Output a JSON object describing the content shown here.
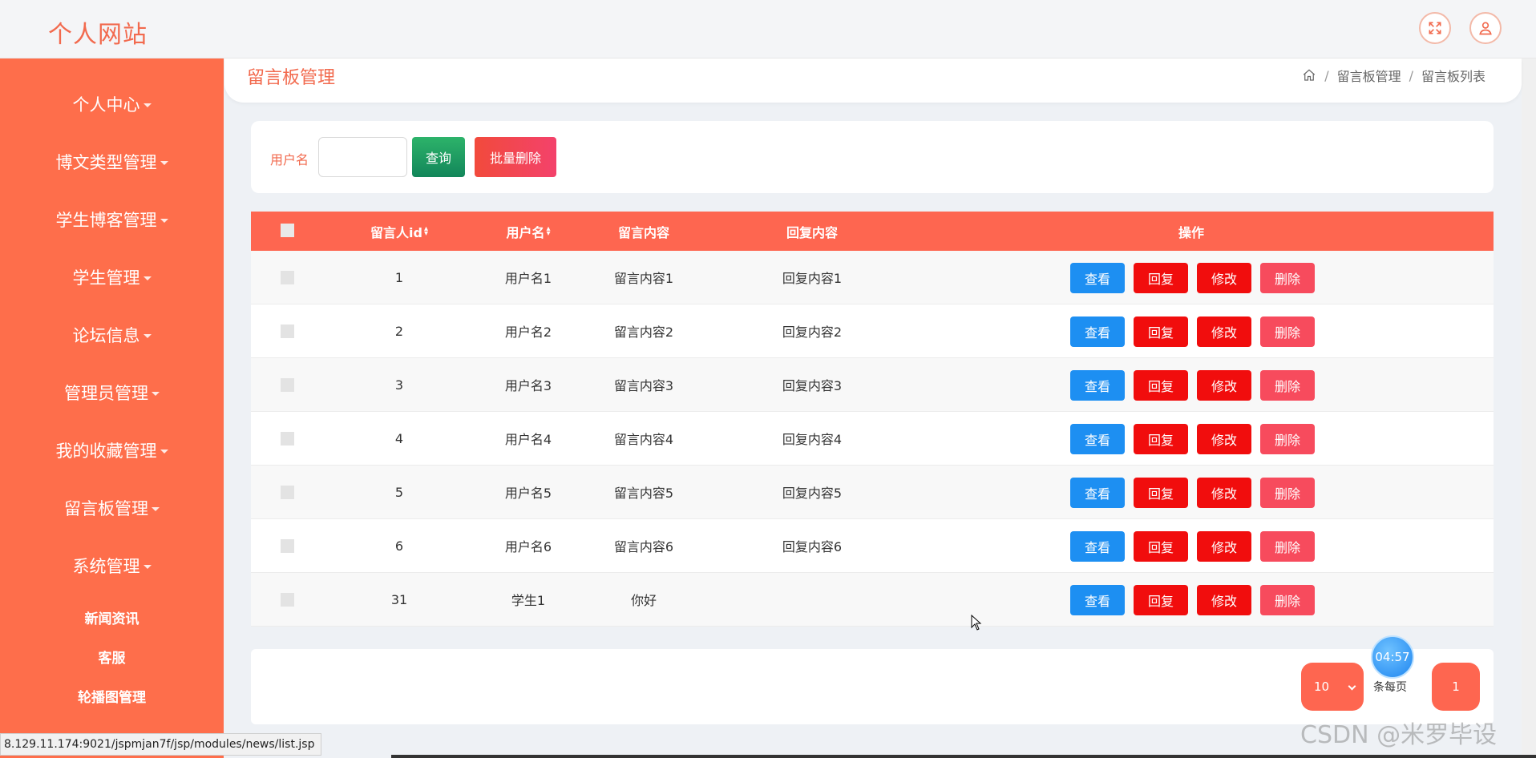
{
  "header": {
    "site_title": "个人网站",
    "fullscreen_icon": "expand-icon",
    "user_icon": "user-icon"
  },
  "sidebar": {
    "items": [
      {
        "label": "个人中心"
      },
      {
        "label": "博文类型管理"
      },
      {
        "label": "学生博客管理"
      },
      {
        "label": "学生管理"
      },
      {
        "label": "论坛信息"
      },
      {
        "label": "管理员管理"
      },
      {
        "label": "我的收藏管理"
      },
      {
        "label": "留言板管理"
      },
      {
        "label": "系统管理"
      }
    ],
    "sub_items": [
      {
        "label": "新闻资讯"
      },
      {
        "label": "客服"
      },
      {
        "label": "轮播图管理"
      }
    ]
  },
  "page": {
    "title": "留言板管理",
    "breadcrumb": [
      "留言板管理",
      "留言板列表"
    ],
    "breadcrumb_separator": "/"
  },
  "search": {
    "label": "用户名",
    "input_value": "",
    "query_label": "查询",
    "batch_delete_label": "批量删除"
  },
  "table": {
    "columns": [
      "留言人id",
      "用户名",
      "留言内容",
      "回复内容",
      "操作"
    ],
    "actions": {
      "view": "查看",
      "reply": "回复",
      "edit": "修改",
      "delete": "删除"
    },
    "rows": [
      {
        "id": "1",
        "username": "用户名1",
        "content": "留言内容1",
        "reply": "回复内容1"
      },
      {
        "id": "2",
        "username": "用户名2",
        "content": "留言内容2",
        "reply": "回复内容2"
      },
      {
        "id": "3",
        "username": "用户名3",
        "content": "留言内容3",
        "reply": "回复内容3"
      },
      {
        "id": "4",
        "username": "用户名4",
        "content": "留言内容4",
        "reply": "回复内容4"
      },
      {
        "id": "5",
        "username": "用户名5",
        "content": "留言内容5",
        "reply": "回复内容5"
      },
      {
        "id": "6",
        "username": "用户名6",
        "content": "留言内容6",
        "reply": "回复内容6"
      },
      {
        "id": "31",
        "username": "学生1",
        "content": "你好",
        "reply": ""
      }
    ]
  },
  "pagination": {
    "page_size": "10",
    "per_page_label": "条每页",
    "current_page": "1"
  },
  "timer": "04:57",
  "status_bar_url": "8.129.11.174:9021/jspmjan7f/jsp/modules/news/list.jsp",
  "watermark": "CSDN @米罗毕设",
  "colors": {
    "accent": "#fe6e4b",
    "table_header": "#fe6650",
    "view_button": "#1d8ff2",
    "reply_button": "#f10d0d",
    "delete_button": "#f74b5d",
    "query_button": "#12865a"
  }
}
